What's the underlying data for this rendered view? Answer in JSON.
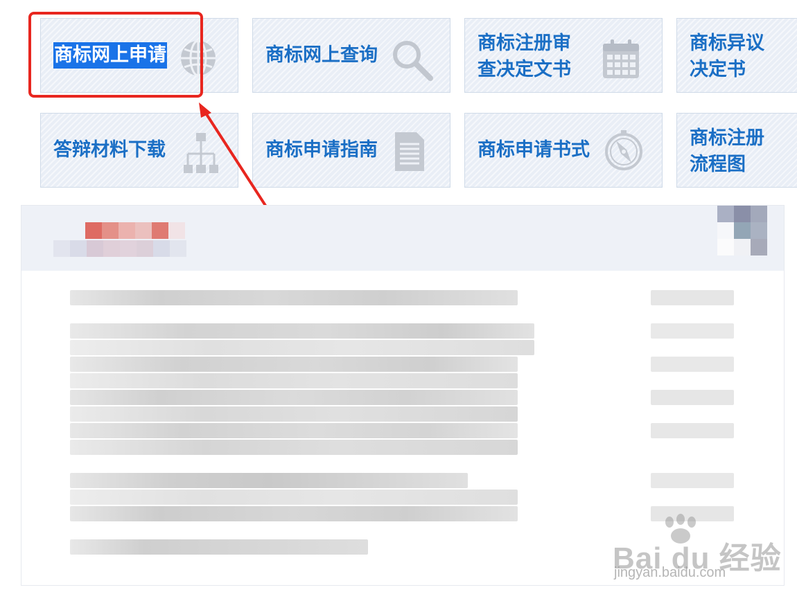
{
  "tiles": [
    {
      "label": "商标网上申请",
      "icon": "globe-icon"
    },
    {
      "label": "商标网上查询",
      "icon": "magnifier-icon"
    },
    {
      "label_lines": [
        "商标注册审",
        "查决定文书"
      ],
      "icon": "calendar-icon"
    },
    {
      "label_lines": [
        "商标异议",
        "决定书"
      ]
    },
    {
      "label": "答辩材料下载",
      "icon": "org-chart-icon"
    },
    {
      "label": "商标申请指南",
      "icon": "document-icon"
    },
    {
      "label": "商标申请书式",
      "icon": "compass-icon"
    },
    {
      "label_lines": [
        "商标注册",
        "流程图"
      ]
    }
  ],
  "annotation": {
    "color": "#e8261f",
    "shape": "red-rectangle-with-arrow"
  },
  "watermark": {
    "brand": "Bai du 经验",
    "url": "jingyan.baidu.com"
  },
  "colors": {
    "tile_text": "#1b6fc5",
    "tile_bg": "#e9eef6",
    "selection": "#1a73e8"
  }
}
